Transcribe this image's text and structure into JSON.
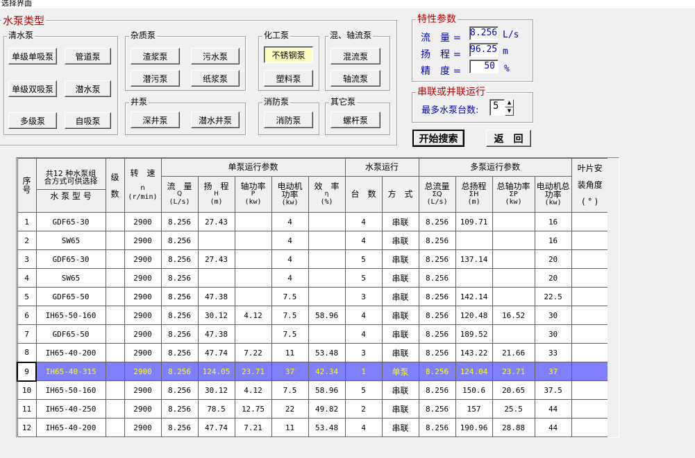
{
  "window": {
    "title": "选择界面"
  },
  "pump_types": {
    "title": "水泵类型",
    "groups": {
      "clear": {
        "label": "清水泵",
        "buttons": [
          "单级单吸泵",
          "管道泵",
          "单级双吸泵",
          "潜水泵",
          "多级泵",
          "自吸泵"
        ]
      },
      "impurity": {
        "label": "杂质泵",
        "buttons": [
          "渣浆泵",
          "污水泵",
          "潜污泵",
          "纸浆泵"
        ]
      },
      "chemical": {
        "label": "化工泵",
        "buttons": [
          "不锈钢泵",
          "塑料泵"
        ]
      },
      "mixed": {
        "label": "混、轴流泵",
        "buttons": [
          "混流泵",
          "轴流泵"
        ]
      },
      "well": {
        "label": "井泵",
        "buttons": [
          "深井泵",
          "潜水井泵"
        ]
      },
      "fire": {
        "label": "消防泵",
        "buttons": [
          "消防泵"
        ]
      },
      "other": {
        "label": "其它泵",
        "buttons": [
          "螺杆泵"
        ]
      }
    }
  },
  "params": {
    "title": "特性参数",
    "flow": {
      "label": "流　量 =",
      "value": "8.256",
      "unit": "L/s"
    },
    "head": {
      "label": "扬　程 =",
      "value": "96.25",
      "unit": "m"
    },
    "precision": {
      "label": "精　度 =",
      "value": "50",
      "unit": "%"
    }
  },
  "series": {
    "title": "串联或并联运行",
    "max_label": "最多水泵台数:",
    "max_value": "5"
  },
  "actions": {
    "search": "开始搜索",
    "back": "返　回"
  },
  "table": {
    "headers": {
      "seq": "序号",
      "choice_top": "共12 种水泵组合方式可供选择",
      "model": "水 泵 型 号",
      "stage": "级数",
      "speed": "转　速",
      "speed_sym": "n",
      "speed_unit": "(r/min)",
      "single_group": "单泵运行参数",
      "flow": "流　量",
      "flow_sym": "Q",
      "flow_unit": "(L/s)",
      "head": "扬　程",
      "head_sym": "H",
      "head_unit": "(m)",
      "shaft": "轴功率",
      "shaft_sym": "P",
      "shaft_unit": "(kw)",
      "motor": "电动机功率",
      "motor_unit": "(kw)",
      "eff": "效　率",
      "eff_sym": "η",
      "eff_unit": "(%)",
      "op_group": "水泵运行",
      "count": "台　数",
      "mode": "方　式",
      "multi_group": "多泵运行参数",
      "tflow": "总流量",
      "tflow_sym": "ΣQ",
      "tflow_unit": "(L/s)",
      "thead": "总扬程",
      "thead_sym": "ΣH",
      "thead_unit": "(m)",
      "tshaft": "总轴功率",
      "tshaft_sym": "ΣP",
      "tshaft_unit": "(kw)",
      "tmotor": "电动机总功率",
      "tmotor_unit": "(kw)",
      "blade": "叶片安",
      "blade2": "装角度",
      "blade_unit": "( ° )"
    },
    "rows": [
      [
        "1",
        "GDF65-30",
        "",
        "2900",
        "8.256",
        "27.43",
        "",
        "4",
        "",
        "4",
        "串联",
        "8.256",
        "109.71",
        "",
        "16",
        ""
      ],
      [
        "2",
        "SW65",
        "",
        "2900",
        "8.256",
        "",
        "",
        "4",
        "",
        "4",
        "串联",
        "8.256",
        "",
        "",
        "16",
        ""
      ],
      [
        "3",
        "GDF65-30",
        "",
        "2900",
        "8.256",
        "27.43",
        "",
        "4",
        "",
        "5",
        "串联",
        "8.256",
        "137.14",
        "",
        "20",
        ""
      ],
      [
        "4",
        "SW65",
        "",
        "2900",
        "8.256",
        "",
        "",
        "4",
        "",
        "5",
        "串联",
        "8.256",
        "",
        "",
        "20",
        ""
      ],
      [
        "5",
        "GDF65-50",
        "",
        "2900",
        "8.256",
        "47.38",
        "",
        "7.5",
        "",
        "3",
        "串联",
        "8.256",
        "142.14",
        "",
        "22.5",
        ""
      ],
      [
        "6",
        "IH65-50-160",
        "",
        "2900",
        "8.256",
        "30.12",
        "4.12",
        "7.5",
        "58.96",
        "4",
        "串联",
        "8.256",
        "120.48",
        "16.52",
        "30",
        ""
      ],
      [
        "7",
        "GDF65-50",
        "",
        "2900",
        "8.256",
        "47.38",
        "",
        "7.5",
        "",
        "4",
        "串联",
        "8.256",
        "189.52",
        "",
        "30",
        ""
      ],
      [
        "8",
        "IH65-40-200",
        "",
        "2900",
        "8.256",
        "47.74",
        "7.22",
        "11",
        "53.48",
        "3",
        "串联",
        "8.256",
        "143.22",
        "21.66",
        "33",
        ""
      ],
      [
        "9",
        "IH65-40-315",
        "",
        "2900",
        "8.256",
        "124.05",
        "23.71",
        "37",
        "42.34",
        "1",
        "单泵",
        "8.256",
        "124.04",
        "23.71",
        "37",
        ""
      ],
      [
        "10",
        "IH65-50-160",
        "",
        "2900",
        "8.256",
        "30.12",
        "4.12",
        "7.5",
        "58.96",
        "5",
        "串联",
        "8.256",
        "150.6",
        "20.65",
        "37.5",
        ""
      ],
      [
        "11",
        "IH65-40-250",
        "",
        "2900",
        "8.256",
        "78.5",
        "12.75",
        "22",
        "49.82",
        "2",
        "串联",
        "8.256",
        "157",
        "25.5",
        "44",
        ""
      ],
      [
        "12",
        "IH65-40-200",
        "",
        "2900",
        "8.256",
        "47.74",
        "7.21",
        "11",
        "53.48",
        "4",
        "串联",
        "8.256",
        "190.96",
        "28.88",
        "44",
        ""
      ]
    ],
    "selected_row": 9
  }
}
